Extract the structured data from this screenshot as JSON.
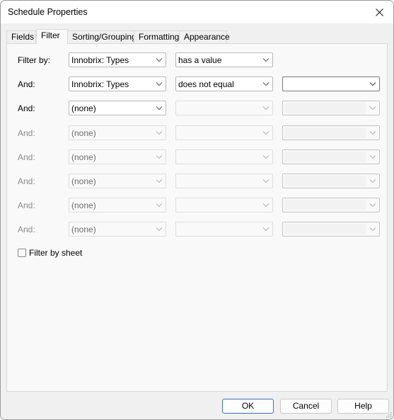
{
  "window": {
    "title": "Schedule Properties"
  },
  "tabs": [
    {
      "label": "Fields",
      "active": false
    },
    {
      "label": "Filter",
      "active": true
    },
    {
      "label": "Sorting/Grouping",
      "active": false
    },
    {
      "label": "Formatting",
      "active": false
    },
    {
      "label": "Appearance",
      "active": false
    }
  ],
  "filter_rows": [
    {
      "label": "Filter by:",
      "label_enabled": true,
      "field": "Innobrix: Types",
      "field_enabled": true,
      "condition": "has a value",
      "condition_enabled": true,
      "value": "",
      "value_visible": false
    },
    {
      "label": "And:",
      "label_enabled": true,
      "field": "Innobrix: Types",
      "field_enabled": true,
      "condition": "does not equal",
      "condition_enabled": true,
      "value": "",
      "value_visible": true,
      "value_enabled": true
    },
    {
      "label": "And:",
      "label_enabled": true,
      "field": "(none)",
      "field_enabled": true,
      "condition": "",
      "condition_enabled": false,
      "value": "",
      "value_visible": true,
      "value_enabled": false
    },
    {
      "label": "And:",
      "label_enabled": false,
      "field": "(none)",
      "field_enabled": false,
      "condition": "",
      "condition_enabled": false,
      "value": "",
      "value_visible": true,
      "value_enabled": false
    },
    {
      "label": "And:",
      "label_enabled": false,
      "field": "(none)",
      "field_enabled": false,
      "condition": "",
      "condition_enabled": false,
      "value": "",
      "value_visible": true,
      "value_enabled": false
    },
    {
      "label": "And:",
      "label_enabled": false,
      "field": "(none)",
      "field_enabled": false,
      "condition": "",
      "condition_enabled": false,
      "value": "",
      "value_visible": true,
      "value_enabled": false
    },
    {
      "label": "And:",
      "label_enabled": false,
      "field": "(none)",
      "field_enabled": false,
      "condition": "",
      "condition_enabled": false,
      "value": "",
      "value_visible": true,
      "value_enabled": false
    },
    {
      "label": "And:",
      "label_enabled": false,
      "field": "(none)",
      "field_enabled": false,
      "condition": "",
      "condition_enabled": false,
      "value": "",
      "value_visible": true,
      "value_enabled": false
    }
  ],
  "filter_by_sheet": {
    "label": "Filter by sheet",
    "checked": false
  },
  "buttons": {
    "ok": "OK",
    "cancel": "Cancel",
    "help": "Help"
  },
  "icons": {
    "close": "close-icon",
    "dropdown": "chevron-down-icon",
    "resize": "resize-grip-icon"
  }
}
